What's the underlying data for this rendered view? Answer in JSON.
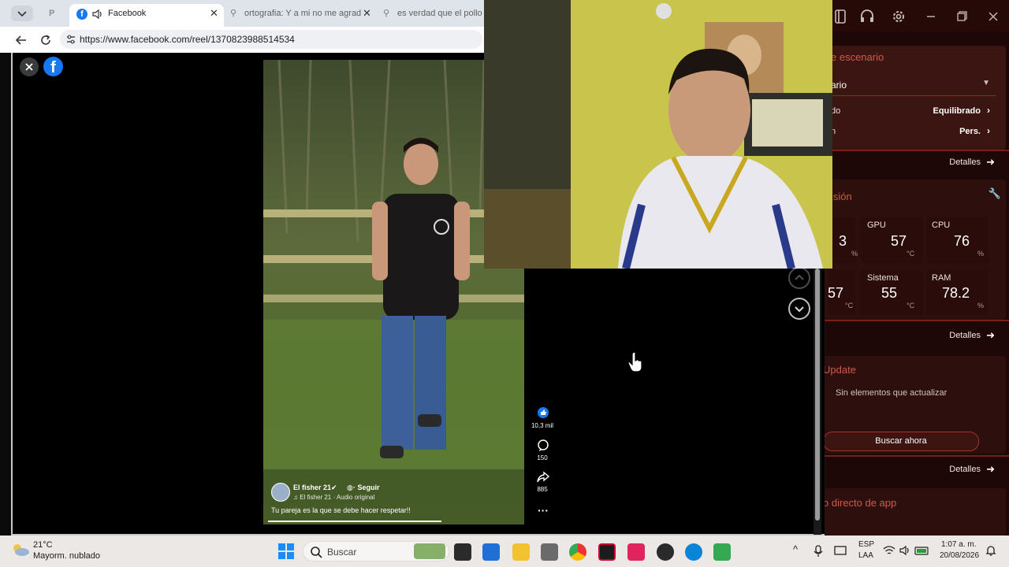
{
  "browser": {
    "tabs": [
      {
        "label": "P",
        "active": false
      },
      {
        "label": "Facebook",
        "active": true
      },
      {
        "label": "ortografia: Y a mi no me agradan",
        "active": false
      },
      {
        "label": "es verdad que el pollo pu",
        "active": false
      }
    ],
    "url": "https://www.facebook.com/reel/1370823988514534"
  },
  "reel": {
    "author": "El fisher 21",
    "follow_label": "Seguir",
    "audio": "El fisher 21 · Audio original",
    "caption": "Tu pareja es la que se debe hacer respetar!!",
    "likes": "10,3 mil",
    "comments": "150",
    "shares": "885"
  },
  "app": {
    "sections": {
      "scenario_title": "e escenario",
      "monitor_title": "isión",
      "update_title": "Update",
      "shortcut_title": "o directo de app"
    },
    "scenario_select": "ario",
    "rows": [
      {
        "label": "do",
        "value": "Equilibrado"
      },
      {
        "label": "n",
        "value": "Pers."
      }
    ],
    "details_label": "Detalles",
    "stats": [
      {
        "label": "GPU",
        "value": "57",
        "unit": "°C"
      },
      {
        "label": "CPU",
        "value": "76",
        "unit": "%"
      },
      {
        "label": "Sistema",
        "value": "55",
        "unit": "°C"
      },
      {
        "label": "RAM",
        "value": "78.2",
        "unit": "%"
      }
    ],
    "partial_stats": [
      {
        "value": "3",
        "unit": "%"
      },
      {
        "value": "57",
        "unit": "°C"
      }
    ],
    "update_status": "Sin elementos que actualizar",
    "search_button": "Buscar ahora",
    "accent_color": "#d05a4a"
  },
  "taskbar": {
    "weather_temp": "21°C",
    "weather_desc": "Mayorm. nublado",
    "search_label": "Buscar",
    "lang_top": "ESP",
    "lang_bottom": "LAA",
    "time": "1:07 a. m.",
    "date": "20/08/2026"
  }
}
